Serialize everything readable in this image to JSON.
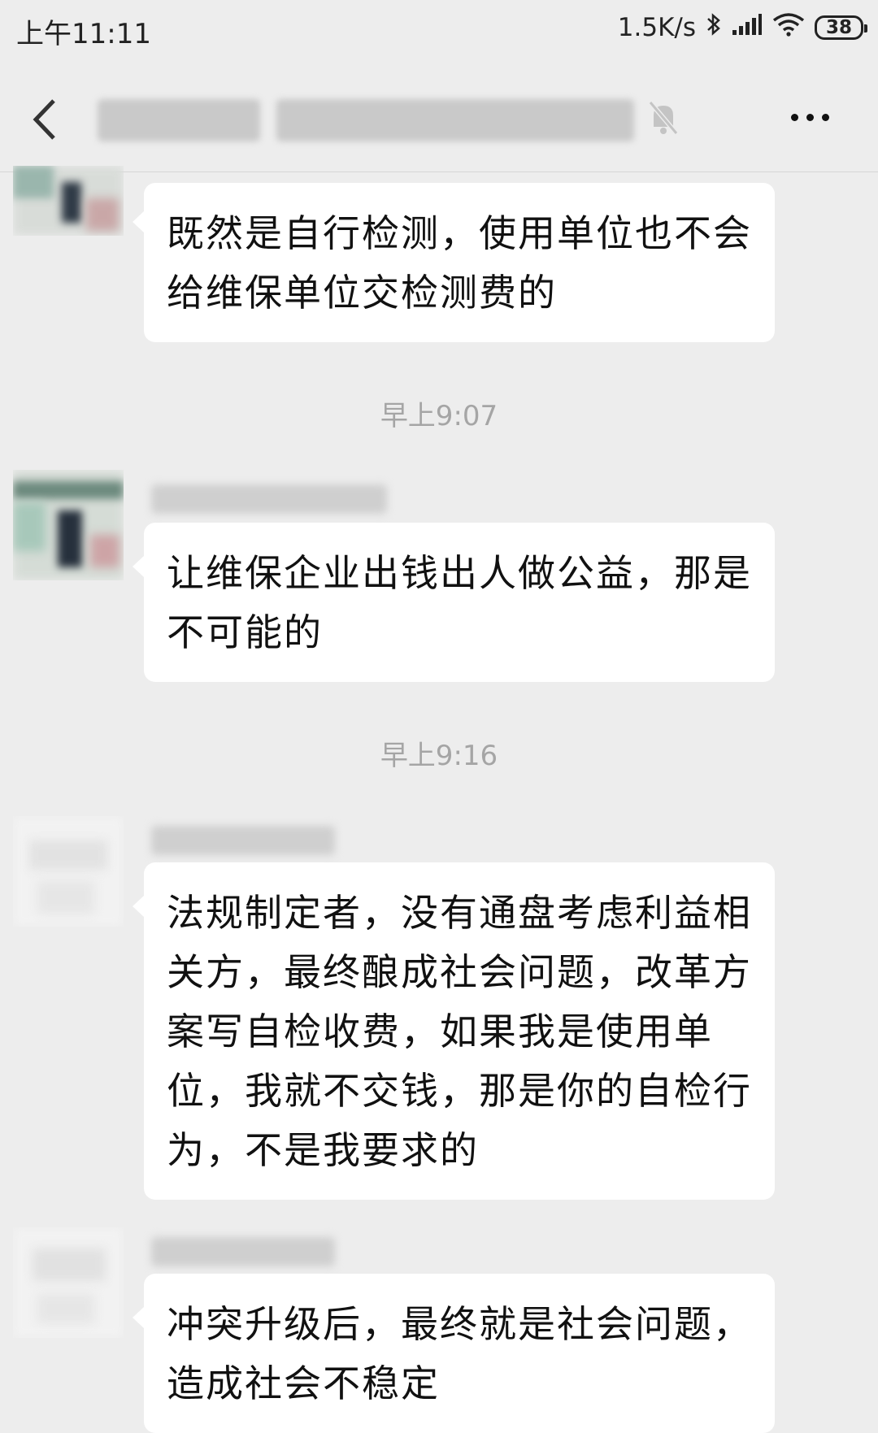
{
  "status_bar": {
    "time": "上午11:11",
    "network_speed": "1.5K/s",
    "battery": "38",
    "icons": [
      "bluetooth-icon",
      "signal-icon",
      "wifi-icon",
      "battery-icon"
    ]
  },
  "header": {
    "title_obscured": true,
    "icons": [
      "back-icon",
      "mute-bell-icon",
      "more-icon"
    ]
  },
  "messages": [
    {
      "text": "既然是自行检测，使用单位也不会给维保单位交检测费的"
    },
    {
      "timestamp": "早上9:07"
    },
    {
      "text": "让维保企业出钱出人做公益，那是不可能的"
    },
    {
      "timestamp": "早上9:16"
    },
    {
      "text": "法规制定者，没有通盘考虑利益相关方，最终酿成社会问题，改革方案写自检收费，如果我是使用单位，我就不交钱，那是你的自检行为，不是我要求的"
    },
    {
      "text": "冲突升级后，最终就是社会问题，造成社会不稳定"
    }
  ],
  "colors": {
    "background": "#ededed",
    "bubble": "#ffffff",
    "timestamp": "#a5a5a5"
  }
}
